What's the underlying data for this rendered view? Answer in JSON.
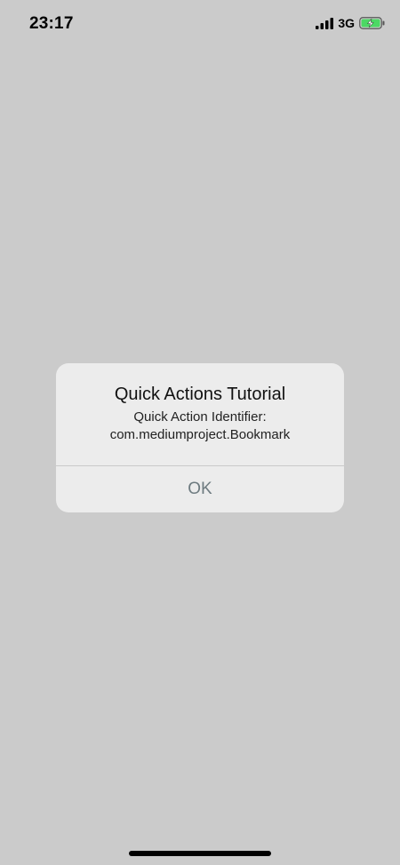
{
  "status_bar": {
    "time": "23:17",
    "network": "3G",
    "signal_icon": "cellular-signal-icon",
    "battery_icon": "battery-charging-icon"
  },
  "alert": {
    "title": "Quick Actions Tutorial",
    "message_line1": "Quick Action Identifier:",
    "message_line2": "com.mediumproject.Bookmark",
    "ok_label": "OK"
  },
  "colors": {
    "background": "#cbcbcb",
    "alert_background": "#ececec",
    "button_text": "#6e7b80",
    "battery_fill": "#4cd964"
  }
}
